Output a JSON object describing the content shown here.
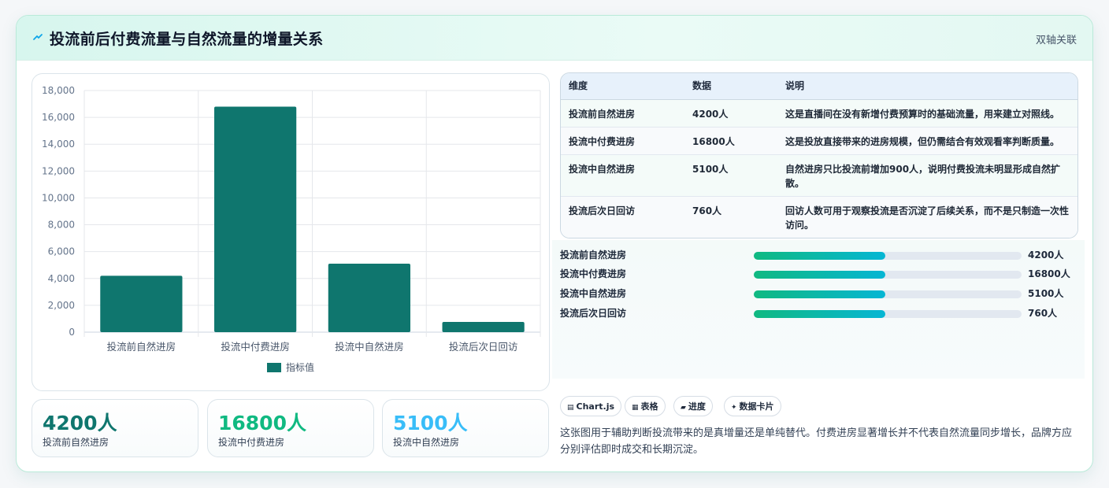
{
  "header": {
    "title": "投流前后付费流量与自然流量的增量关系",
    "badge": "双轴关联"
  },
  "chart_data": {
    "type": "bar",
    "categories": [
      "投流前自然进房",
      "投流中付费进房",
      "投流中自然进房",
      "投流后次日回访"
    ],
    "series": [
      {
        "name": "指标值",
        "values": [
          4200,
          16800,
          5100,
          760
        ],
        "color": "#0f766e"
      }
    ],
    "ylim": [
      0,
      18000
    ],
    "yticks": [
      "0",
      "2,000",
      "4,000",
      "6,000",
      "8,000",
      "10,000",
      "12,000",
      "14,000",
      "16,000",
      "18,000"
    ],
    "legend": "bottom",
    "grid": true
  },
  "table": {
    "headers": [
      "维度",
      "数据",
      "说明"
    ],
    "rows": [
      [
        "投流前自然进房",
        "4200人",
        "这是直播间在没有新增付费预算时的基础流量，用来建立对照线。"
      ],
      [
        "投流中付费进房",
        "16800人",
        "这是投放直接带来的进房规模，但仍需结合有效观看率判断质量。"
      ],
      [
        "投流中自然进房",
        "5100人",
        "自然进房只比投流前增加900人，说明付费投流未明显形成自然扩散。"
      ],
      [
        "投流后次日回访",
        "760人",
        "回访人数可用于观察投流是否沉淀了后续关系，而不是只制造一次性访问。"
      ]
    ]
  },
  "progress": [
    {
      "label": "投流前自然进房",
      "value": "4200人",
      "fraction": 0.49
    },
    {
      "label": "投流中付费进房",
      "value": "16800人",
      "fraction": 0.49
    },
    {
      "label": "投流中自然进房",
      "value": "5100人",
      "fraction": 0.49
    },
    {
      "label": "投流后次日回访",
      "value": "760人",
      "fraction": 0.49
    }
  ],
  "chips": [
    {
      "icon": "▤",
      "label": "Chart.js"
    },
    {
      "icon": "▦",
      "label": "表格"
    },
    {
      "icon": "▰",
      "label": "进度"
    },
    {
      "icon": "✦",
      "label": "数据卡片"
    }
  ],
  "description": "这张图用于辅助判断投流带来的是真增量还是单纯替代。付费进房显著增长并不代表自然流量同步增长，品牌方应分别评估即时成交和长期沉淀。",
  "kpis": [
    {
      "value": "4200人",
      "label": "投流前自然进房",
      "color": "#0f766e"
    },
    {
      "value": "16800人",
      "label": "投流中付费进房",
      "color": "#10b981"
    },
    {
      "value": "5100人",
      "label": "投流中自然进房",
      "color": "#38bdf8"
    }
  ]
}
